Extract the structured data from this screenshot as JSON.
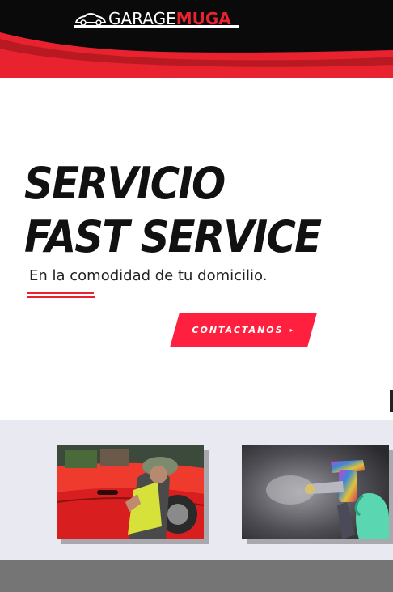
{
  "header": {
    "logo": {
      "part1": "GARAGE",
      "part2": "MUGA"
    },
    "colors": {
      "black": "#0a0a0a",
      "red": "#e8232f"
    }
  },
  "hero": {
    "title_line1": "SERVICIO",
    "title_line2": "FAST SERVICE",
    "subtitle": "En la comodidad de tu domicilio.",
    "cta_label": "CONTACTANOS",
    "cta_arrow": "▸",
    "cta_color": "#ff1f3e"
  },
  "services": {
    "cards": [
      {
        "image": "red-car-worker-photo",
        "caption": ""
      },
      {
        "image": "spray-paint-gun-photo",
        "caption": ""
      }
    ]
  }
}
